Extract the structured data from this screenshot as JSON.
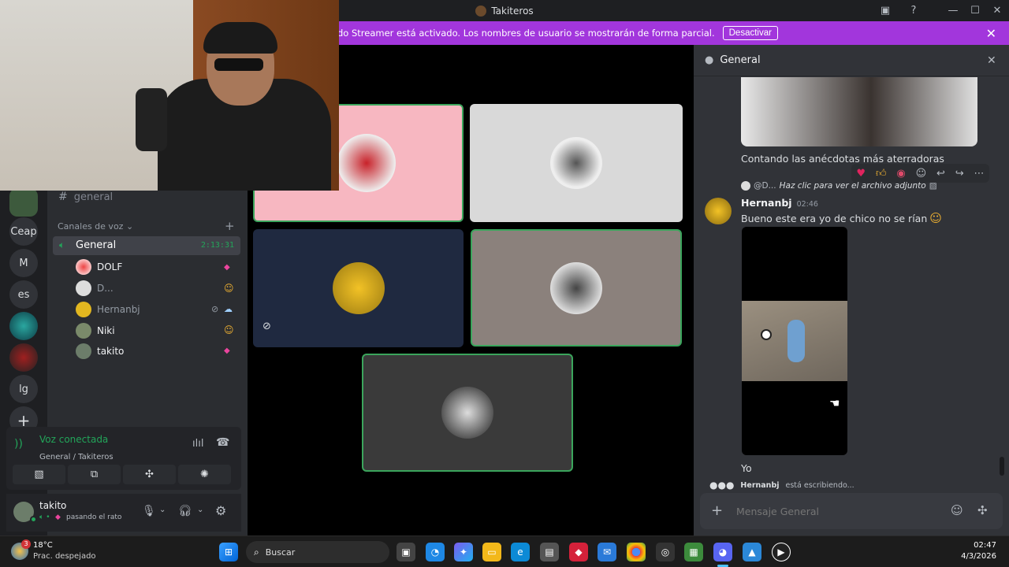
{
  "window": {
    "title": "Takiteros"
  },
  "banner": {
    "text": "do Streamer está activado. Los nombres de usuario se mostrarán de forma parcial.",
    "button": "Desactivar"
  },
  "servers": {
    "items": [
      "Ceap",
      "M",
      "es",
      "lg"
    ]
  },
  "channels": {
    "text_channel": "general",
    "voice_category": "Canales de voz",
    "voice_channel": "General",
    "voice_timer": "2:13:31",
    "voice_users": [
      {
        "name": "DOLF"
      },
      {
        "name": "D..."
      },
      {
        "name": "Hernanbj"
      },
      {
        "name": "Niki"
      },
      {
        "name": "takito"
      }
    ]
  },
  "voice_status": {
    "title": "Voz conectada",
    "subtitle": "General / Takiteros"
  },
  "user": {
    "name": "takito",
    "status": "pasando el rato"
  },
  "chat": {
    "header": "General",
    "prev_caption": "Contando las anécdotas más aterradoras",
    "reply_ref": "@D...",
    "reply_text": "Haz clic para ver el archivo adjunto",
    "author": "Hernanbj",
    "time": "02:46",
    "message": "Bueno este era yo de chico no se rían",
    "message2": "Yo",
    "typing_user": "Hernanbj",
    "typing_suffix": "está escribiendo...",
    "input_placeholder": "Mensaje General"
  },
  "taskbar": {
    "weather_temp": "18°C",
    "weather_desc": "Prac. despejado",
    "weather_badge": "3",
    "search": "Buscar",
    "time": "02:47",
    "date": "4/3/2026"
  },
  "colors": {
    "banner": "#a236dc",
    "speaking": "#3ba55c",
    "voice_green": "#23a55a"
  }
}
